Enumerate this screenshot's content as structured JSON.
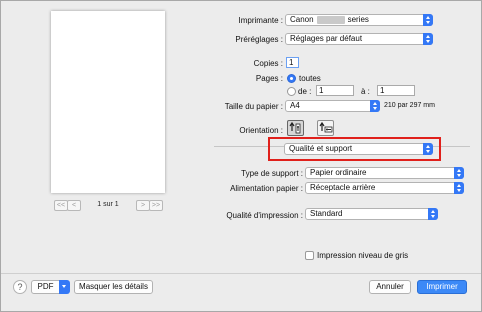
{
  "preview": {
    "page_indicator": "1 sur 1",
    "first_label": "<<",
    "prev_label": "<",
    "next_label": ">",
    "last_label": ">>"
  },
  "printer": {
    "label": "Imprimante :",
    "name_prefix": "Canon",
    "name_suffix": "series"
  },
  "presets": {
    "label": "Préréglages :",
    "value": "Réglages par défaut"
  },
  "copies": {
    "label": "Copies :",
    "value": "1"
  },
  "pages": {
    "label": "Pages :",
    "all_label": "toutes",
    "from_label": "de :",
    "from_value": "1",
    "to_label": "à :",
    "to_value": "1"
  },
  "paper_size": {
    "label": "Taille du papier :",
    "value": "A4",
    "dimensions": "210 par 297 mm"
  },
  "orientation": {
    "label": "Orientation :"
  },
  "section": {
    "value": "Qualité et support"
  },
  "media_type": {
    "label": "Type de support :",
    "value": "Papier ordinaire"
  },
  "paper_source": {
    "label": "Alimentation papier :",
    "value": "Réceptacle arrière"
  },
  "print_quality": {
    "label": "Qualité d'impression :",
    "value": "Standard"
  },
  "grayscale": {
    "label": "Impression niveau de gris",
    "checked": false
  },
  "footer": {
    "help": "?",
    "pdf": "PDF",
    "hide_details": "Masquer les détails",
    "cancel": "Annuler",
    "print": "Imprimer"
  },
  "colors": {
    "accent": "#3478f6",
    "highlight": "#e0201b"
  }
}
